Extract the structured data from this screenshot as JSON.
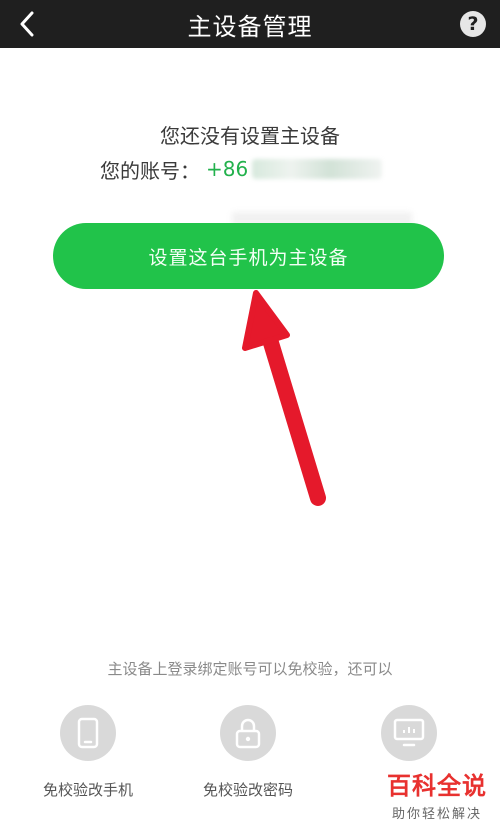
{
  "header": {
    "title": "主设备管理",
    "back_icon": "chevron-left-icon",
    "help_symbol": "?"
  },
  "notice": {
    "title": "您还没有设置主设备",
    "account_label": "您的账号：",
    "account_prefix": "+86"
  },
  "main_action": {
    "label": "设置这台手机为主设备",
    "color": "#21c34a"
  },
  "footnote": "主设备上登录绑定账号可以免校验，还可以",
  "features": [
    {
      "label": "免校验改手机",
      "icon": "phone-icon"
    },
    {
      "label": "免校验改密码",
      "icon": "lock-icon"
    }
  ],
  "watermark": {
    "main": "百科全说",
    "sub": "助你轻松解决"
  },
  "colors": {
    "header_bg": "#1f1f1f",
    "accent_green": "#21c34a",
    "annotation_arrow": "#e5192b"
  }
}
